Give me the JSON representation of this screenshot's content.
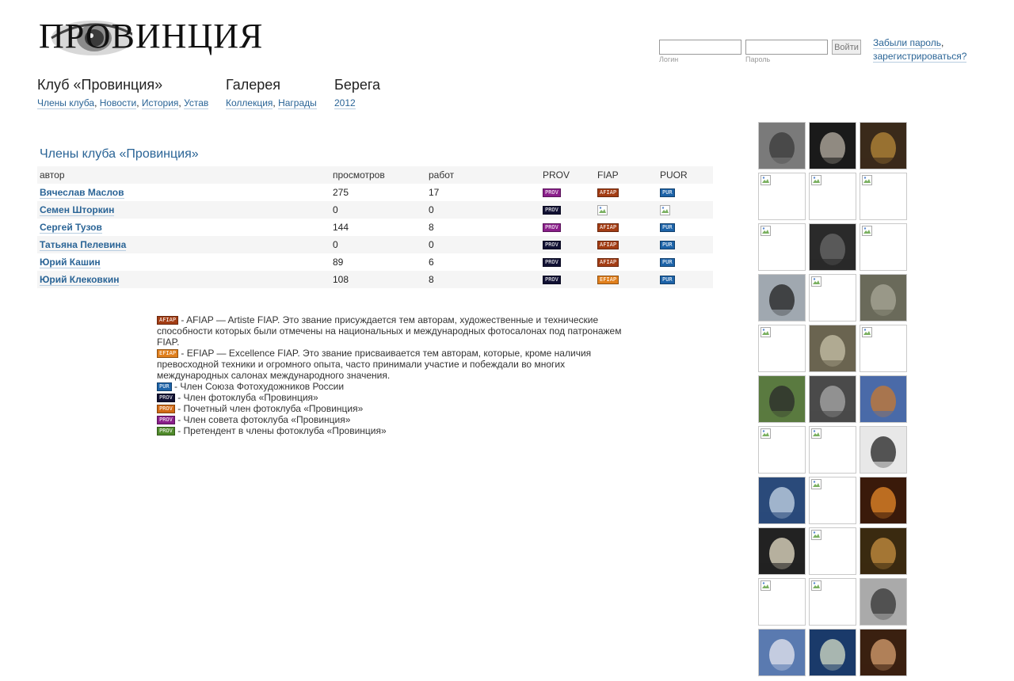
{
  "logo": {
    "text": "ПРОВИНЦИЯ"
  },
  "login": {
    "login_caption": "Логин",
    "password_caption": "Пароль",
    "login_value": "",
    "password_value": "",
    "submit_label": "Войти",
    "forgot_link": "Забыли пароль",
    "register_link": "зарегистрироваться?"
  },
  "nav": {
    "club": {
      "title": "Клуб «Провинция»",
      "links": [
        "Члены клуба",
        "Новости",
        "История",
        "Устав"
      ]
    },
    "gallery": {
      "title": "Галерея",
      "links": [
        "Коллекция",
        "Награды"
      ]
    },
    "shores": {
      "title": "Берега",
      "links": [
        "2012"
      ]
    }
  },
  "members": {
    "title": "Члены клуба «Провинция»",
    "columns": [
      "автор",
      "просмотров",
      "работ",
      "PROV",
      "FIAP",
      "PUOR"
    ],
    "rows": [
      {
        "name": "Вячеслав Маслов",
        "views": "275",
        "works": "17",
        "prov": "PROV",
        "prov_color": "#8a1f8a",
        "fiap": "AFIAP",
        "fiap_color": "#a33d14",
        "puor": "PUR"
      },
      {
        "name": "Семен Шторкин",
        "views": "0",
        "works": "0",
        "prov": "PROV",
        "prov_color": "#111133",
        "fiap": "",
        "fiap_color": "",
        "puor": ""
      },
      {
        "name": "Сергей Тузов",
        "views": "144",
        "works": "8",
        "prov": "PROV",
        "prov_color": "#8a1f8a",
        "fiap": "AFIAP",
        "fiap_color": "#a33d14",
        "puor": "PUR"
      },
      {
        "name": "Татьяна Пелевина",
        "views": "0",
        "works": "0",
        "prov": "PROV",
        "prov_color": "#111133",
        "fiap": "AFIAP",
        "fiap_color": "#a33d14",
        "puor": "PUR"
      },
      {
        "name": "Юрий Кашин",
        "views": "89",
        "works": "6",
        "prov": "PROV",
        "prov_color": "#111133",
        "fiap": "AFIAP",
        "fiap_color": "#a33d14",
        "puor": "PUR"
      },
      {
        "name": "Юрий Клековкин",
        "views": "108",
        "works": "8",
        "prov": "PROV",
        "prov_color": "#111133",
        "fiap": "EFIAP",
        "fiap_color": "#e07f1c",
        "puor": "PUR"
      }
    ]
  },
  "legend": [
    {
      "badge": "AFIAP",
      "color": "#a33d14",
      "text": " - AFIAP — Artiste FIAP. Это звание присуждается тем авторам, художественные и технические способности которых были отмечены на национальных и международных фотосалонах под патронажем FIAP."
    },
    {
      "badge": "EFIAP",
      "color": "#e07f1c",
      "text": " - EFIAP — Excellence FIAP. Это звание присваивается тем авторам, которые, кроме наличия превосходной техники и огромного опыта, часто принимали участие и побеждали во многих международных салонах международного значения."
    },
    {
      "badge": "PUR",
      "color": "#1d63a8",
      "text": " - Член Союза Фотохудожников России"
    },
    {
      "badge": "PROV",
      "color": "#111133",
      "text": " - Член фотоклуба «Провинция»"
    },
    {
      "badge": "PROV",
      "color": "#d26a15",
      "text": " - Почетный член фотоклуба «Провинция»"
    },
    {
      "badge": "PROV",
      "color": "#8a1f8a",
      "text": " - Член совета фотоклуба «Провинция»"
    },
    {
      "badge": "PROV",
      "color": "#4f8a2a",
      "text": " - Претендент в члены фотоклуба «Провинция»"
    }
  ],
  "gallery": {
    "thumbs": [
      {
        "kind": "photo",
        "bg": "#7a7a7a",
        "fg": "#3a3a3a"
      },
      {
        "kind": "photo",
        "bg": "#1a1a1a",
        "fg": "#b8b0a4"
      },
      {
        "kind": "photo",
        "bg": "#3a2a1a",
        "fg": "#b88a3a"
      },
      {
        "kind": "broken"
      },
      {
        "kind": "broken"
      },
      {
        "kind": "broken"
      },
      {
        "kind": "broken"
      },
      {
        "kind": "photo",
        "bg": "#2a2a2a",
        "fg": "#6a6a6a"
      },
      {
        "kind": "broken"
      },
      {
        "kind": "photo",
        "bg": "#a0a8b0",
        "fg": "#202020"
      },
      {
        "kind": "broken"
      },
      {
        "kind": "photo",
        "bg": "#6a6a5a",
        "fg": "#aaa898"
      },
      {
        "kind": "broken"
      },
      {
        "kind": "photo",
        "bg": "#6a6450",
        "fg": "#c8c2a8"
      },
      {
        "kind": "broken"
      },
      {
        "kind": "photo",
        "bg": "#5a7a40",
        "fg": "#2a2a2a"
      },
      {
        "kind": "photo",
        "bg": "#4a4a4a",
        "fg": "#aaaaaa"
      },
      {
        "kind": "photo",
        "bg": "#4a6aa8",
        "fg": "#c87a30"
      },
      {
        "kind": "broken"
      },
      {
        "kind": "broken"
      },
      {
        "kind": "photo",
        "bg": "#e8e8e8",
        "fg": "#222222"
      },
      {
        "kind": "photo",
        "bg": "#2a4a7a",
        "fg": "#c8d8e8"
      },
      {
        "kind": "broken"
      },
      {
        "kind": "photo",
        "bg": "#3a1a0a",
        "fg": "#e88a2a"
      },
      {
        "kind": "photo",
        "bg": "#222222",
        "fg": "#e8e0c8"
      },
      {
        "kind": "broken"
      },
      {
        "kind": "photo",
        "bg": "#3a2a10",
        "fg": "#c89040"
      },
      {
        "kind": "broken"
      },
      {
        "kind": "broken"
      },
      {
        "kind": "photo",
        "bg": "#aaaaaa",
        "fg": "#333333"
      },
      {
        "kind": "photo",
        "bg": "#5a7ab0",
        "fg": "#e8e8f0"
      },
      {
        "kind": "photo",
        "bg": "#1a3a6a",
        "fg": "#d8e0c8"
      },
      {
        "kind": "photo",
        "bg": "#3a2010",
        "fg": "#d8a070"
      }
    ]
  }
}
